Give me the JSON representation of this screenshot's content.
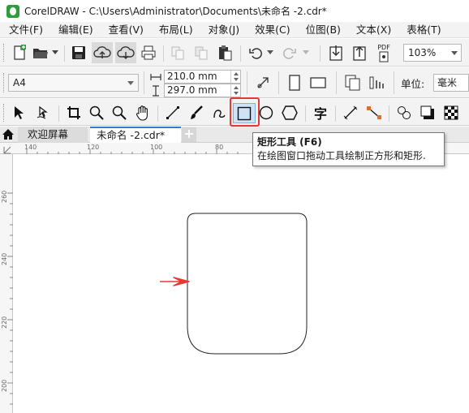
{
  "window": {
    "title": "CorelDRAW - C:\\Users\\Administrator\\Documents\\未命名 -2.cdr*"
  },
  "menu": {
    "items": [
      {
        "label": "文件(F)"
      },
      {
        "label": "编辑(E)"
      },
      {
        "label": "查看(V)"
      },
      {
        "label": "布局(L)"
      },
      {
        "label": "对象(J)"
      },
      {
        "label": "效果(C)"
      },
      {
        "label": "位图(B)"
      },
      {
        "label": "文本(X)"
      },
      {
        "label": "表格(T)"
      }
    ]
  },
  "standard_toolbar": {
    "zoom_level": "103%",
    "icons": [
      "new-document-icon",
      "open-folder-icon",
      "save-icon",
      "cloud-upload-icon",
      "cloud-download-icon",
      "print-icon",
      "cut-icon",
      "copy-icon",
      "paste-icon",
      "undo-icon",
      "redo-icon",
      "import-icon",
      "export-icon",
      "publish-pdf-icon"
    ],
    "pdf_label": "PDF"
  },
  "property_bar": {
    "paper_size": "A4",
    "width": "210.0 mm",
    "height": "297.0 mm",
    "unit_label": "单位:",
    "unit_value": "毫米"
  },
  "toolbox": {
    "active_tool": "rectangle-tool",
    "text_tool_glyph": "字"
  },
  "tabs": {
    "welcome": "欢迎屏幕",
    "document": "未命名 -2.cdr*",
    "add": "+"
  },
  "rulers": {
    "horizontal": [
      "140",
      "120",
      "100",
      "80"
    ],
    "vertical": [
      "260",
      "240",
      "220",
      "200"
    ]
  },
  "tooltip": {
    "title": "矩形工具 (F6)",
    "description": "在绘图窗口拖动工具绘制正方形和矩形."
  },
  "colors": {
    "highlight": "#e53935",
    "arrow": "#e53935",
    "accent": "#2a7fd4",
    "active_tool_bg": "#cfe3f7"
  }
}
